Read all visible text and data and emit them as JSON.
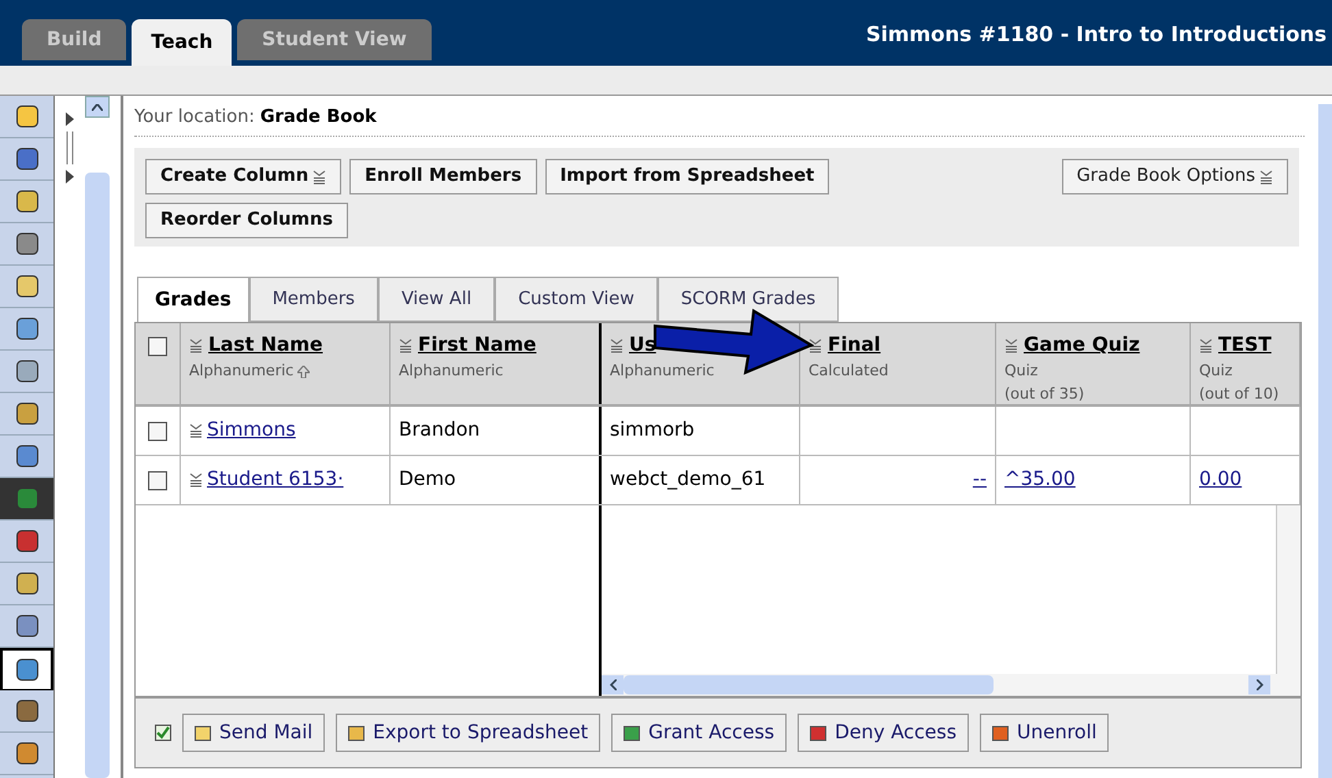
{
  "top_tabs": [
    {
      "label": "Build",
      "selected": false
    },
    {
      "label": "Teach",
      "selected": true
    },
    {
      "label": "Student View",
      "selected": false
    }
  ],
  "course_title": "Simmons #1180 - Intro to Introductions",
  "tools": [
    {
      "selected": false
    },
    {
      "selected": false
    },
    {
      "selected": false
    },
    {
      "selected": false
    },
    {
      "selected": false
    },
    {
      "selected": false
    },
    {
      "selected": false
    },
    {
      "selected": false
    },
    {
      "selected": false
    },
    {
      "selected": false
    },
    {
      "selected": false
    },
    {
      "selected": false
    },
    {
      "selected": false
    },
    {
      "selected": true
    },
    {
      "selected": false
    },
    {
      "selected": false
    }
  ],
  "location": {
    "label": "Your location:",
    "value": "Grade Book"
  },
  "toolbar": [
    {
      "label": "Create Column",
      "menu": true
    },
    {
      "label": "Enroll Members",
      "menu": false
    },
    {
      "label": "Import from Spreadsheet",
      "menu": false
    },
    {
      "label": "Reorder Columns",
      "menu": false
    }
  ],
  "options_button": {
    "label": "Grade Book Options",
    "menu": true
  },
  "grade_tabs": [
    {
      "label": "Grades",
      "selected": true
    },
    {
      "label": "Members",
      "selected": false
    },
    {
      "label": "View All",
      "selected": false
    },
    {
      "label": "Custom View",
      "selected": false
    },
    {
      "label": "SCORM Grades",
      "selected": false
    }
  ],
  "table": {
    "select_all_checked": false,
    "columns": [
      {
        "title": "Last Name",
        "subtitle": "Alphanumeric",
        "sorted": true
      },
      {
        "title": "First Name",
        "subtitle": "Alphanumeric",
        "sorted": false
      },
      {
        "title": "Us",
        "subtitle": "Alphanumeric",
        "sorted": false
      },
      {
        "title": "Final",
        "subtitle": "Calculated",
        "sorted": false
      },
      {
        "title": "Game Quiz",
        "subtitle": "Quiz",
        "max": "(out of 35)",
        "sorted": false
      },
      {
        "title": "TEST",
        "subtitle": "Quiz",
        "max": "(out of 10)",
        "sorted": false
      }
    ],
    "rows": [
      {
        "checked": false,
        "cells": [
          "Simmons",
          "Brandon",
          "simmorb",
          "",
          "",
          ""
        ]
      },
      {
        "checked": false,
        "cells": [
          "Student 6153·",
          "Demo",
          "webct_demo_61",
          "--",
          "^35.00",
          "0.00"
        ]
      }
    ]
  },
  "actions": [
    {
      "label": "Send Mail",
      "kind": "mail"
    },
    {
      "label": "Export to Spreadsheet",
      "kind": "export"
    },
    {
      "label": "Grant Access",
      "kind": "grant"
    },
    {
      "label": "Deny Access",
      "kind": "deny"
    },
    {
      "label": "Unenroll",
      "kind": "unenroll"
    }
  ]
}
